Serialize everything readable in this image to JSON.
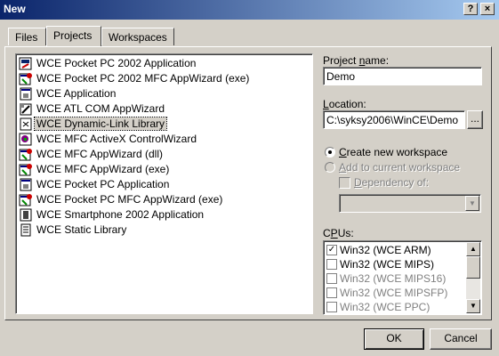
{
  "window": {
    "title": "New",
    "help_button": "?",
    "close_button": "×"
  },
  "tabs": [
    {
      "label": "Files"
    },
    {
      "label": "Projects"
    },
    {
      "label": "Workspaces"
    }
  ],
  "project_types": [
    {
      "label": "WCE  Pocket  PC  2002  Application",
      "icon": "pocketpc-app-icon"
    },
    {
      "label": "WCE  Pocket  PC  2002  MFC  AppWizard  (exe)",
      "icon": "mfc-wizard-icon"
    },
    {
      "label": "WCE Application",
      "icon": "application-icon"
    },
    {
      "label": "WCE ATL COM AppWizard",
      "icon": "atl-com-icon"
    },
    {
      "label": "WCE Dynamic-Link Library",
      "icon": "dll-icon"
    },
    {
      "label": "WCE MFC ActiveX ControlWizard",
      "icon": "activex-icon"
    },
    {
      "label": "WCE MFC AppWizard (dll)",
      "icon": "mfc-wizard-icon"
    },
    {
      "label": "WCE MFC AppWizard (exe)",
      "icon": "mfc-wizard-icon"
    },
    {
      "label": "WCE Pocket PC Application",
      "icon": "application-icon"
    },
    {
      "label": "WCE Pocket PC MFC AppWizard (exe)",
      "icon": "mfc-wizard-icon"
    },
    {
      "label": "WCE Smartphone 2002 Application",
      "icon": "smartphone-app-icon"
    },
    {
      "label": "WCE Static Library",
      "icon": "static-library-icon"
    }
  ],
  "selected_project_type": "WCE Dynamic-Link Library",
  "project_name": {
    "label_pre": "Project ",
    "label_ul": "n",
    "label_post": "ame:",
    "value": "Demo"
  },
  "location": {
    "label_pre": "",
    "label_ul": "L",
    "label_post": "ocation:",
    "value": "C:\\syksy2006\\WinCE\\Demo",
    "browse_label": "..."
  },
  "workspace": {
    "create_ul": "C",
    "create_rest": "reate new workspace",
    "add_ul": "A",
    "add_rest": "dd to current workspace",
    "dependency_ul": "D",
    "dependency_rest": "ependency of:",
    "selected": "create"
  },
  "cpus": {
    "label_pre": "C",
    "label_ul": "P",
    "label_post": "Us:",
    "items": [
      {
        "label": "Win32 (WCE ARM)",
        "checked": true,
        "enabled": true
      },
      {
        "label": "Win32 (WCE MIPS)",
        "checked": false,
        "enabled": true
      },
      {
        "label": "Win32 (WCE MIPS16)",
        "checked": false,
        "enabled": false
      },
      {
        "label": "Win32 (WCE MIPSFP)",
        "checked": false,
        "enabled": false
      },
      {
        "label": "Win32 (WCE PPC)",
        "checked": false,
        "enabled": false
      }
    ]
  },
  "buttons": {
    "ok": "OK",
    "cancel": "Cancel"
  },
  "colors": {
    "titlebar_start": "#0a246a",
    "titlebar_end": "#a6caf0",
    "face": "#d4d0c8"
  }
}
